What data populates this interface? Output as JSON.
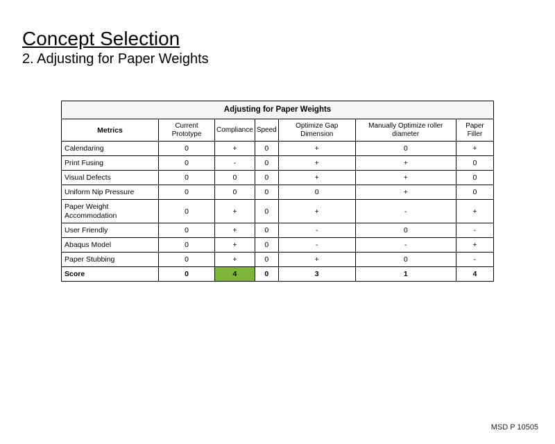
{
  "title": "Concept Selection",
  "subtitle": "2. Adjusting for Paper Weights",
  "footer": "MSD P 10505",
  "chart_data": {
    "type": "table",
    "title": "Adjusting for Paper Weights",
    "row_header_label": "Metrics",
    "columns": [
      "Current Prototype",
      "Compliance",
      "Speed",
      "Optimize Gap Dimension",
      "Manually Optimize roller diameter",
      "Paper Filler"
    ],
    "rows": [
      {
        "metric": "Calendaring",
        "values": [
          "0",
          "+",
          "0",
          "+",
          "0",
          "+"
        ]
      },
      {
        "metric": "Print Fusing",
        "values": [
          "0",
          "-",
          "0",
          "+",
          "+",
          "0"
        ]
      },
      {
        "metric": "Visual Defects",
        "values": [
          "0",
          "0",
          "0",
          "+",
          "+",
          "0"
        ]
      },
      {
        "metric": "Uniform Nip Pressure",
        "values": [
          "0",
          "0",
          "0",
          "0",
          "+",
          "0"
        ]
      },
      {
        "metric": "Paper Weight Accommodation",
        "values": [
          "0",
          "+",
          "0",
          "+",
          "-",
          "+"
        ]
      },
      {
        "metric": "User Friendly",
        "values": [
          "0",
          "+",
          "0",
          "-",
          "0",
          "-"
        ]
      },
      {
        "metric": "Abaqus Model",
        "values": [
          "0",
          "+",
          "0",
          "-",
          "-",
          "+"
        ]
      },
      {
        "metric": "Paper Stubbing",
        "values": [
          "0",
          "+",
          "0",
          "+",
          "0",
          "-"
        ]
      }
    ],
    "score": {
      "label": "Score",
      "values": [
        "0",
        "4",
        "0",
        "3",
        "1",
        "4"
      ],
      "highlight_index": 1
    }
  }
}
